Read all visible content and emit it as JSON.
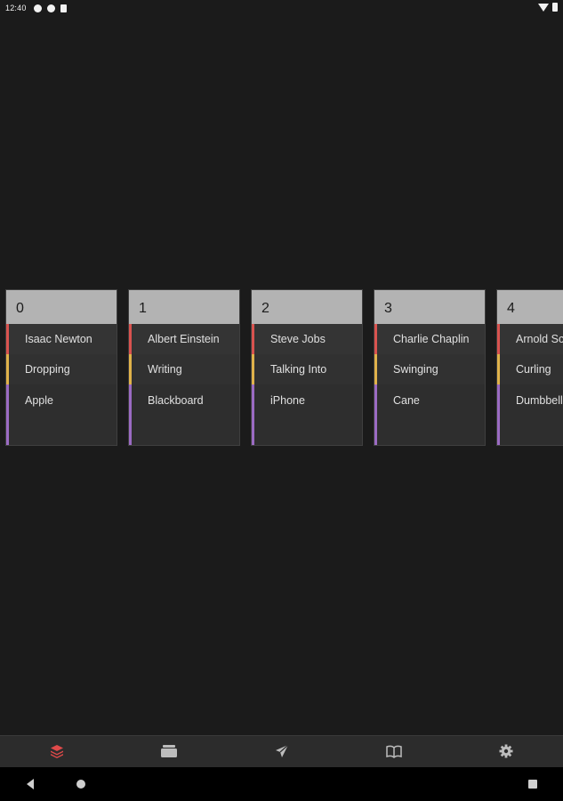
{
  "status_bar": {
    "time": "12:40"
  },
  "colors": {
    "background": "#1b1b1b",
    "card_header": "#b3b3b3",
    "accent_red": "#d9534f",
    "accent_yellow": "#e0b24a",
    "accent_purple": "#9b6bc3",
    "nav_active": "#e04a4a",
    "nav_inactive": "#bdbdbd"
  },
  "cards": [
    {
      "index": "0",
      "items": [
        "Isaac Newton",
        "Dropping",
        "Apple"
      ]
    },
    {
      "index": "1",
      "items": [
        "Albert Einstein",
        "Writing",
        "Blackboard"
      ]
    },
    {
      "index": "2",
      "items": [
        "Steve Jobs",
        "Talking Into",
        "iPhone"
      ]
    },
    {
      "index": "3",
      "items": [
        "Charlie Chaplin",
        "Swinging",
        "Cane"
      ]
    },
    {
      "index": "4",
      "items": [
        "Arnold Schwarzenegger",
        "Curling",
        "Dumbbell"
      ]
    }
  ],
  "bottom_nav": [
    {
      "name": "stack-icon",
      "active": true
    },
    {
      "name": "folder-icon",
      "active": false
    },
    {
      "name": "send-icon",
      "active": false
    },
    {
      "name": "book-icon",
      "active": false
    },
    {
      "name": "settings-icon",
      "active": false
    }
  ],
  "system_nav": [
    "back-icon",
    "home-icon",
    "recents-icon"
  ]
}
